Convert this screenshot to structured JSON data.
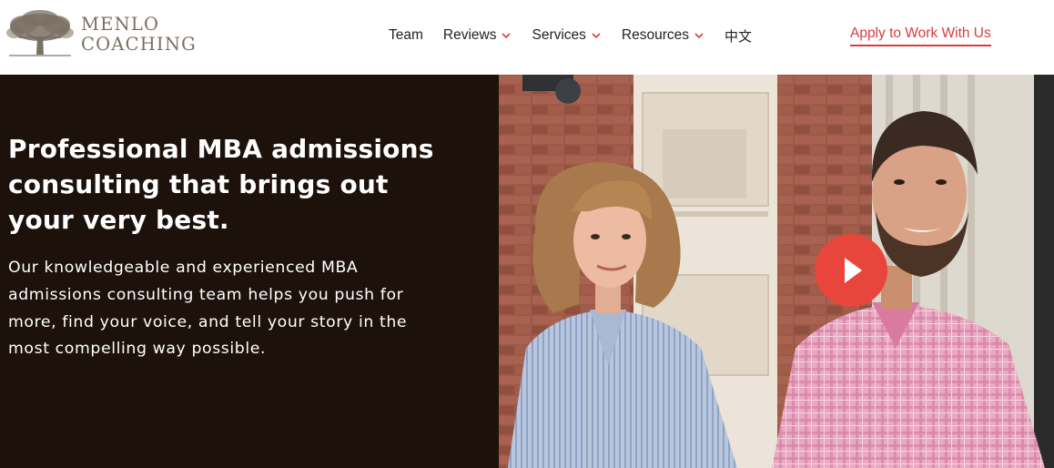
{
  "brand": {
    "line1": "MENLO",
    "line2": "COACHING",
    "logo_icon": "oak-tree-icon",
    "color": "#7a6f63"
  },
  "nav": {
    "items": [
      {
        "label": "Team",
        "has_dropdown": false
      },
      {
        "label": "Reviews",
        "has_dropdown": true
      },
      {
        "label": "Services",
        "has_dropdown": true
      },
      {
        "label": "Resources",
        "has_dropdown": true
      },
      {
        "label": "中文",
        "has_dropdown": false
      }
    ],
    "dropdown_icon": "chevron-down-icon",
    "chevron_color": "#d93c3c"
  },
  "cta": {
    "label": "Apply to Work With Us",
    "color": "#d93c3c"
  },
  "hero": {
    "title": "Professional MBA admissions consulting that brings out your very best.",
    "body": "Our knowledgeable and experienced MBA admissions consulting team helps you push for more, find your voice, and tell your story in the most compelling way possible.",
    "background": "#1d120b",
    "video_play_icon": "play-icon",
    "play_color": "#e8453c"
  }
}
